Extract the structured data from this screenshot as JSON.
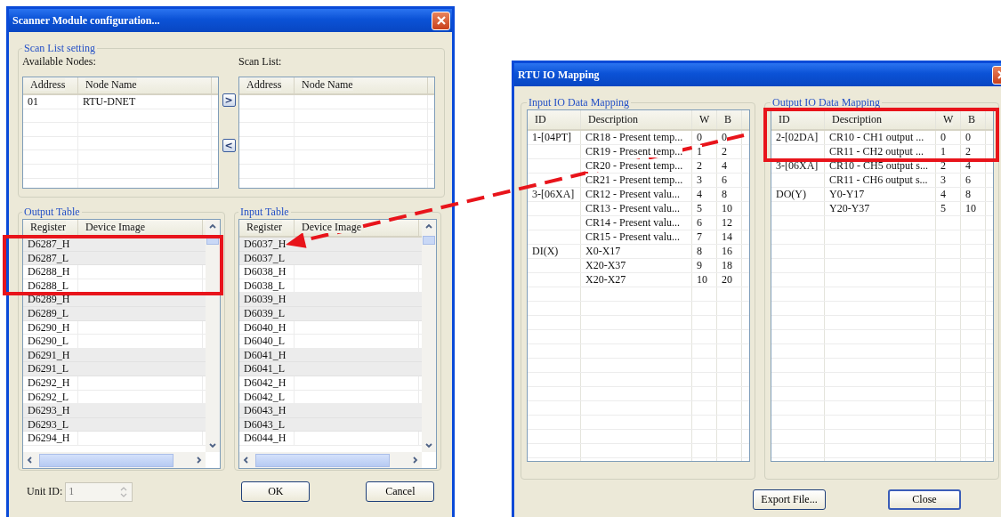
{
  "scanner_window": {
    "title": "Scanner Module configuration...",
    "scan_list_group": {
      "title": "Scan List setting",
      "available_nodes": {
        "label": "Available Nodes:",
        "columns": [
          "Address",
          "Node Name"
        ],
        "rows": [
          {
            "address": "01",
            "node_name": "RTU-DNET"
          }
        ]
      },
      "add_button": ">",
      "remove_button": "<",
      "scan_list": {
        "label": "Scan List:",
        "columns": [
          "Address",
          "Node Name"
        ]
      }
    },
    "output_table": {
      "title": "Output Table",
      "columns": [
        "Register",
        "Device Image"
      ],
      "rows": [
        {
          "register": "D6287_H"
        },
        {
          "register": "D6287_L"
        },
        {
          "register": "D6288_H"
        },
        {
          "register": "D6288_L"
        },
        {
          "register": "D6289_H"
        },
        {
          "register": "D6289_L"
        },
        {
          "register": "D6290_H"
        },
        {
          "register": "D6290_L"
        },
        {
          "register": "D6291_H"
        },
        {
          "register": "D6291_L"
        },
        {
          "register": "D6292_H"
        },
        {
          "register": "D6292_L"
        },
        {
          "register": "D6293_H"
        },
        {
          "register": "D6293_L"
        },
        {
          "register": "D6294_H"
        }
      ]
    },
    "input_table": {
      "title": "Input Table",
      "columns": [
        "Register",
        "Device Image"
      ],
      "rows": [
        {
          "register": "D6037_H"
        },
        {
          "register": "D6037_L"
        },
        {
          "register": "D6038_H"
        },
        {
          "register": "D6038_L"
        },
        {
          "register": "D6039_H"
        },
        {
          "register": "D6039_L"
        },
        {
          "register": "D6040_H"
        },
        {
          "register": "D6040_L"
        },
        {
          "register": "D6041_H"
        },
        {
          "register": "D6041_L"
        },
        {
          "register": "D6042_H"
        },
        {
          "register": "D6042_L"
        },
        {
          "register": "D6043_H"
        },
        {
          "register": "D6043_L"
        },
        {
          "register": "D6044_H"
        }
      ]
    },
    "unit_id": {
      "label": "Unit ID:",
      "value": "1"
    },
    "buttons": [
      "OK",
      "Cancel"
    ]
  },
  "rtu_window": {
    "title": "RTU IO Mapping",
    "input_mapping": {
      "title": "Input IO Data Mapping",
      "columns": [
        "ID",
        "Description",
        "W",
        "B"
      ],
      "rows": [
        {
          "id": "1-[04PT]",
          "description": "CR18 - Present temp...",
          "w": "0",
          "b": "0"
        },
        {
          "description": "CR19 - Present temp...",
          "w": "1",
          "b": "2"
        },
        {
          "description": "CR20 - Present temp...",
          "w": "2",
          "b": "4"
        },
        {
          "description": "CR21 - Present temp...",
          "w": "3",
          "b": "6"
        },
        {
          "id": "3-[06XA]",
          "description": "CR12 - Present valu...",
          "w": "4",
          "b": "8"
        },
        {
          "description": "CR13 - Present valu...",
          "w": "5",
          "b": "10"
        },
        {
          "description": "CR14 - Present valu...",
          "w": "6",
          "b": "12"
        },
        {
          "description": "CR15 - Present valu...",
          "w": "7",
          "b": "14"
        },
        {
          "id": "DI(X)",
          "description": "X0-X17",
          "w": "8",
          "b": "16"
        },
        {
          "description": "X20-X37",
          "w": "9",
          "b": "18"
        },
        {
          "description": "X20-X27",
          "w": "10",
          "b": "20"
        }
      ]
    },
    "output_mapping": {
      "title": "Output IO Data Mapping",
      "columns": [
        "ID",
        "Description",
        "W",
        "B"
      ],
      "rows": [
        {
          "id": "2-[02DA]",
          "description": "CR10 - CH1 output ...",
          "w": "0",
          "b": "0"
        },
        {
          "description": "CR11 - CH2 output ...",
          "w": "1",
          "b": "2"
        },
        {
          "id": "3-[06XA]",
          "description": "CR10 - CH5 output s...",
          "w": "2",
          "b": "4"
        },
        {
          "description": "CR11 - CH6 output s...",
          "w": "3",
          "b": "6"
        },
        {
          "id": "DO(Y)",
          "description": "Y0-Y17",
          "w": "4",
          "b": "8"
        },
        {
          "description": "Y20-Y37",
          "w": "5",
          "b": "10"
        }
      ]
    },
    "buttons": [
      "Export File...",
      "Close"
    ]
  },
  "annotations": [
    {
      "kind": "highlight_box"
    },
    {
      "kind": "highlight_box"
    },
    {
      "kind": "dashed_arrow"
    }
  ]
}
